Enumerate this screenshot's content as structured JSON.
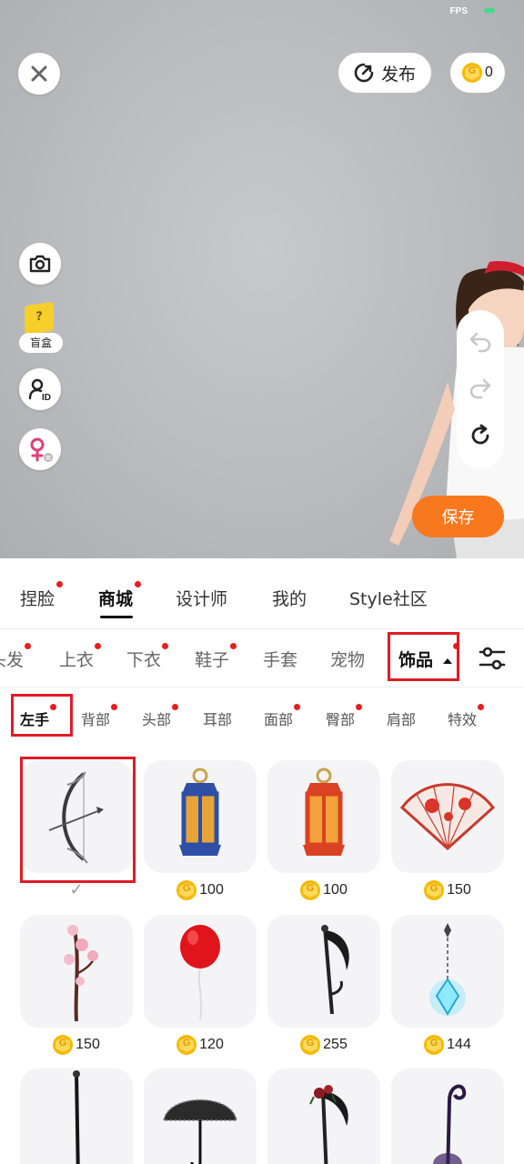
{
  "status": {
    "fps_label": "FPS"
  },
  "header": {
    "publish_label": "发布",
    "coin_balance": "0"
  },
  "side_tools": {
    "blind_box_label": "盲盒",
    "blind_box_glyph": "?"
  },
  "actions": {
    "save_label": "保存"
  },
  "main_tabs": [
    {
      "label": "捏脸",
      "dot": true
    },
    {
      "label": "商城",
      "dot": true,
      "active": true
    },
    {
      "label": "设计师",
      "dot": false
    },
    {
      "label": "我的",
      "dot": false
    },
    {
      "label": "Style社区",
      "dot": false
    }
  ],
  "sub_tabs": [
    {
      "label": "头发",
      "dot": true
    },
    {
      "label": "上衣",
      "dot": true
    },
    {
      "label": "下衣",
      "dot": true
    },
    {
      "label": "鞋子",
      "dot": true
    },
    {
      "label": "手套",
      "dot": false
    },
    {
      "label": "宠物",
      "dot": false
    },
    {
      "label": "饰品",
      "dot": true,
      "active": true
    }
  ],
  "leaf_tabs": [
    {
      "label": "左手",
      "dot": true,
      "active": true
    },
    {
      "label": "背部",
      "dot": true
    },
    {
      "label": "头部",
      "dot": true
    },
    {
      "label": "耳部",
      "dot": false
    },
    {
      "label": "面部",
      "dot": true
    },
    {
      "label": "臀部",
      "dot": true
    },
    {
      "label": "肩部",
      "dot": false
    },
    {
      "label": "特效",
      "dot": true
    }
  ],
  "items": [
    {
      "name": "bow",
      "price": null,
      "owned": true
    },
    {
      "name": "blue-lantern",
      "price": "100"
    },
    {
      "name": "red-lantern",
      "price": "100"
    },
    {
      "name": "folding-fan",
      "price": "150"
    },
    {
      "name": "cherry-blossom-branch",
      "price": "150"
    },
    {
      "name": "red-balloon",
      "price": "120"
    },
    {
      "name": "scythe",
      "price": "255"
    },
    {
      "name": "crystal-pendulum",
      "price": "144"
    },
    {
      "name": "black-staff",
      "price": null
    },
    {
      "name": "lace-umbrella",
      "price": null
    },
    {
      "name": "rose-scythe",
      "price": null
    },
    {
      "name": "curled-staff",
      "price": null
    }
  ],
  "colors": {
    "accent": "#f8781e",
    "highlight": "#e11b25",
    "notice_dot": "#e81e1e",
    "coin": "#f6b900"
  }
}
